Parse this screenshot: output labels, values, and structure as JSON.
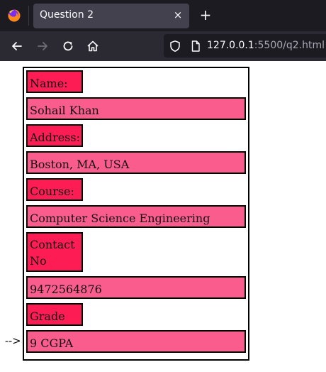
{
  "browser": {
    "tab_title": "Question 2",
    "tab_close": "×",
    "new_tab": "+",
    "url_host": "127.0.0.1",
    "url_rest": ":5500/q2.html"
  },
  "form": {
    "name_label": "Name:",
    "name_value": "Sohail Khan",
    "address_label": "Address:",
    "address_value": "Boston, MA, USA",
    "course_label": "Course:",
    "course_value": "Computer Science Engineering",
    "contact_label_line1": "Contact",
    "contact_label_line2": "No",
    "contact_value": "9472564876",
    "grade_label": "Grade",
    "grade_value": "9 CGPA"
  },
  "pointer": "-->",
  "colors": {
    "label_bg": "#fe1c55",
    "value_bg": "#fb5c8e"
  }
}
